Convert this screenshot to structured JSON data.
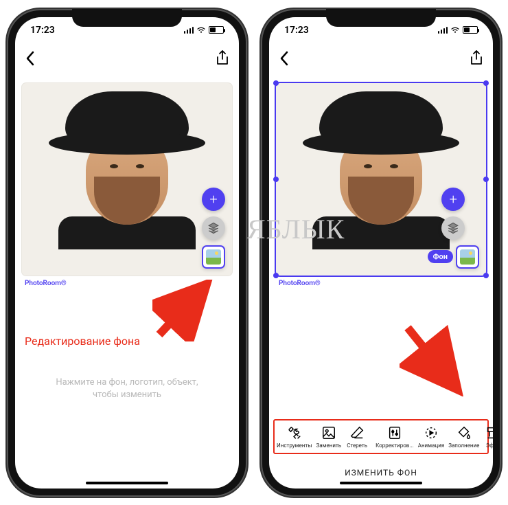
{
  "status": {
    "time": "17:23"
  },
  "app": {
    "brand": "PhotoRoom®"
  },
  "left": {
    "annotation": "Редактирование фона",
    "hint_line1": "Нажмите на фон, логотип, объект,",
    "hint_line2": "чтобы изменить"
  },
  "right": {
    "bg_label": "Фон",
    "bottom_title": "ИЗМЕНИТЬ ФОН",
    "tools": [
      {
        "label": "Инструменты"
      },
      {
        "label": "Заменить"
      },
      {
        "label": "Стереть"
      },
      {
        "label": "Корректиров..."
      },
      {
        "label": "Анимация"
      },
      {
        "label": "Заполнение"
      },
      {
        "label": "Эфф"
      }
    ]
  },
  "watermark": "ЯБЛЫК"
}
